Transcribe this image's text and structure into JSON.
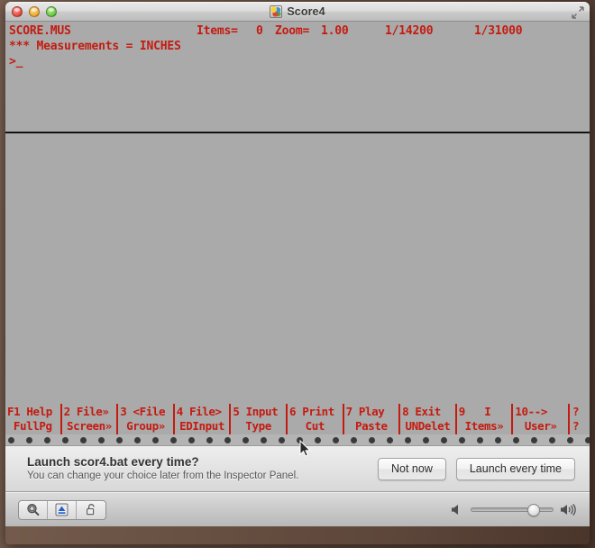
{
  "window": {
    "title": "Score4",
    "app_icon": "score4-app-icon",
    "controls": {
      "close": "close-window-button",
      "minimize": "minimize-window-button",
      "zoom": "zoom-window-button",
      "resize": "resize-window-icon"
    }
  },
  "terminal": {
    "filename": "SCORE.MUS",
    "items_label": "Items=",
    "items_value": "0",
    "zoom_label": "Zoom=",
    "zoom_value": "1.00",
    "ratio_1": "1/14200",
    "ratio_2": "1/31000",
    "measurements_line": "*** Measurements = INCHES",
    "prompt": ">_"
  },
  "function_keys": [
    {
      "top": "F1 Help",
      "bottom": "FullPg"
    },
    {
      "top": "2 File»",
      "bottom": "Screen»"
    },
    {
      "top": "3 <File",
      "bottom": "Group»"
    },
    {
      "top": "4 File>",
      "bottom": "EDInput"
    },
    {
      "top": "5 Input",
      "bottom": "Type"
    },
    {
      "top": "6 Print",
      "bottom": "Cut"
    },
    {
      "top": "7 Play",
      "bottom": "Paste"
    },
    {
      "top": "8 Exit",
      "bottom": "UNDelet"
    },
    {
      "top": "9   I",
      "bottom": "Items»"
    },
    {
      "top": "10-->",
      "bottom": "User»"
    },
    {
      "top": "?",
      "bottom": "?"
    }
  ],
  "notification": {
    "title": "Launch scor4.bat every time?",
    "subtitle": "You can change your choice later from the Inspector Panel.",
    "buttons": {
      "secondary": "Not now",
      "primary": "Launch every time"
    }
  },
  "statusbar": {
    "tools": [
      {
        "name": "inspector-magnifier-icon"
      },
      {
        "name": "eject-disk-icon"
      },
      {
        "name": "unlocked-padlock-icon"
      }
    ],
    "volume": {
      "low_icon": "volume-low-icon",
      "high_icon": "volume-high-icon",
      "level_percent": "80"
    }
  },
  "colors": {
    "terminal_text": "#c41b10",
    "terminal_bg": "#aaaaaa",
    "desktop": "#6a5244"
  }
}
